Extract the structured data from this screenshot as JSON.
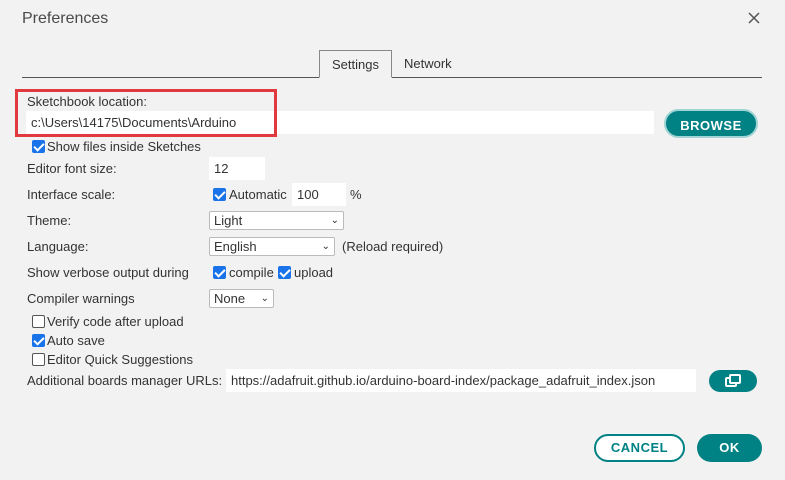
{
  "dialog": {
    "title": "Preferences"
  },
  "tabs": [
    {
      "label": "Settings",
      "active": true
    },
    {
      "label": "Network",
      "active": false
    }
  ],
  "sketchbook": {
    "label": "Sketchbook location:",
    "value": "c:\\Users\\14175\\Documents\\Arduino",
    "browse_label": "BROWSE"
  },
  "show_files": {
    "label": "Show files inside Sketches",
    "checked": true
  },
  "font_size": {
    "label": "Editor font size:",
    "value": "12"
  },
  "interface_scale": {
    "label": "Interface scale:",
    "automatic_label": "Automatic",
    "automatic_checked": true,
    "value": "100",
    "unit": "%"
  },
  "theme": {
    "label": "Theme:",
    "selected": "Light"
  },
  "language": {
    "label": "Language:",
    "selected": "English",
    "note": "(Reload required)"
  },
  "verbose": {
    "label": "Show verbose output during",
    "compile_label": "compile",
    "compile_checked": true,
    "upload_label": "upload",
    "upload_checked": true
  },
  "compiler_warnings": {
    "label": "Compiler warnings",
    "selected": "None"
  },
  "verify": {
    "label": "Verify code after upload",
    "checked": false
  },
  "autosave": {
    "label": "Auto save",
    "checked": true
  },
  "quick_suggestions": {
    "label": "Editor Quick Suggestions",
    "checked": false
  },
  "boards_urls": {
    "label": "Additional boards manager URLs:",
    "value": "https://adafruit.github.io/arduino-board-index/package_adafruit_index.json"
  },
  "footer": {
    "cancel_label": "CANCEL",
    "ok_label": "OK"
  },
  "colors": {
    "accent": "#008184",
    "checkbox": "#1a73e8",
    "highlight": "#e0393e",
    "background": "#f2f2f2"
  }
}
